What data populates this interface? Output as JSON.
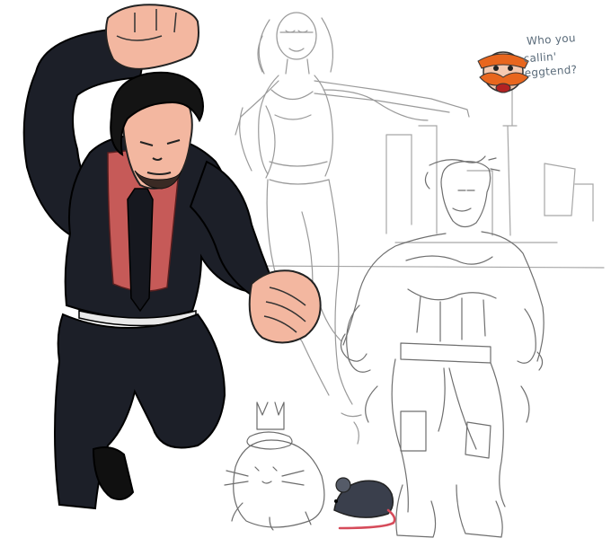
{
  "sketch_page": {
    "caption": {
      "line1": "Who you",
      "line2": "callin' eggtend?"
    },
    "colors": {
      "suit": "#1c1f28",
      "shirt": "#c65a58",
      "skin": "#f3b7a0",
      "hair": "#141414",
      "sketch_line": "#9a9a9a",
      "rat": "#3a3f4c",
      "rat_tail": "#d64b5a",
      "egghead_orange": "#e8661e",
      "background": "#ffffff"
    }
  }
}
